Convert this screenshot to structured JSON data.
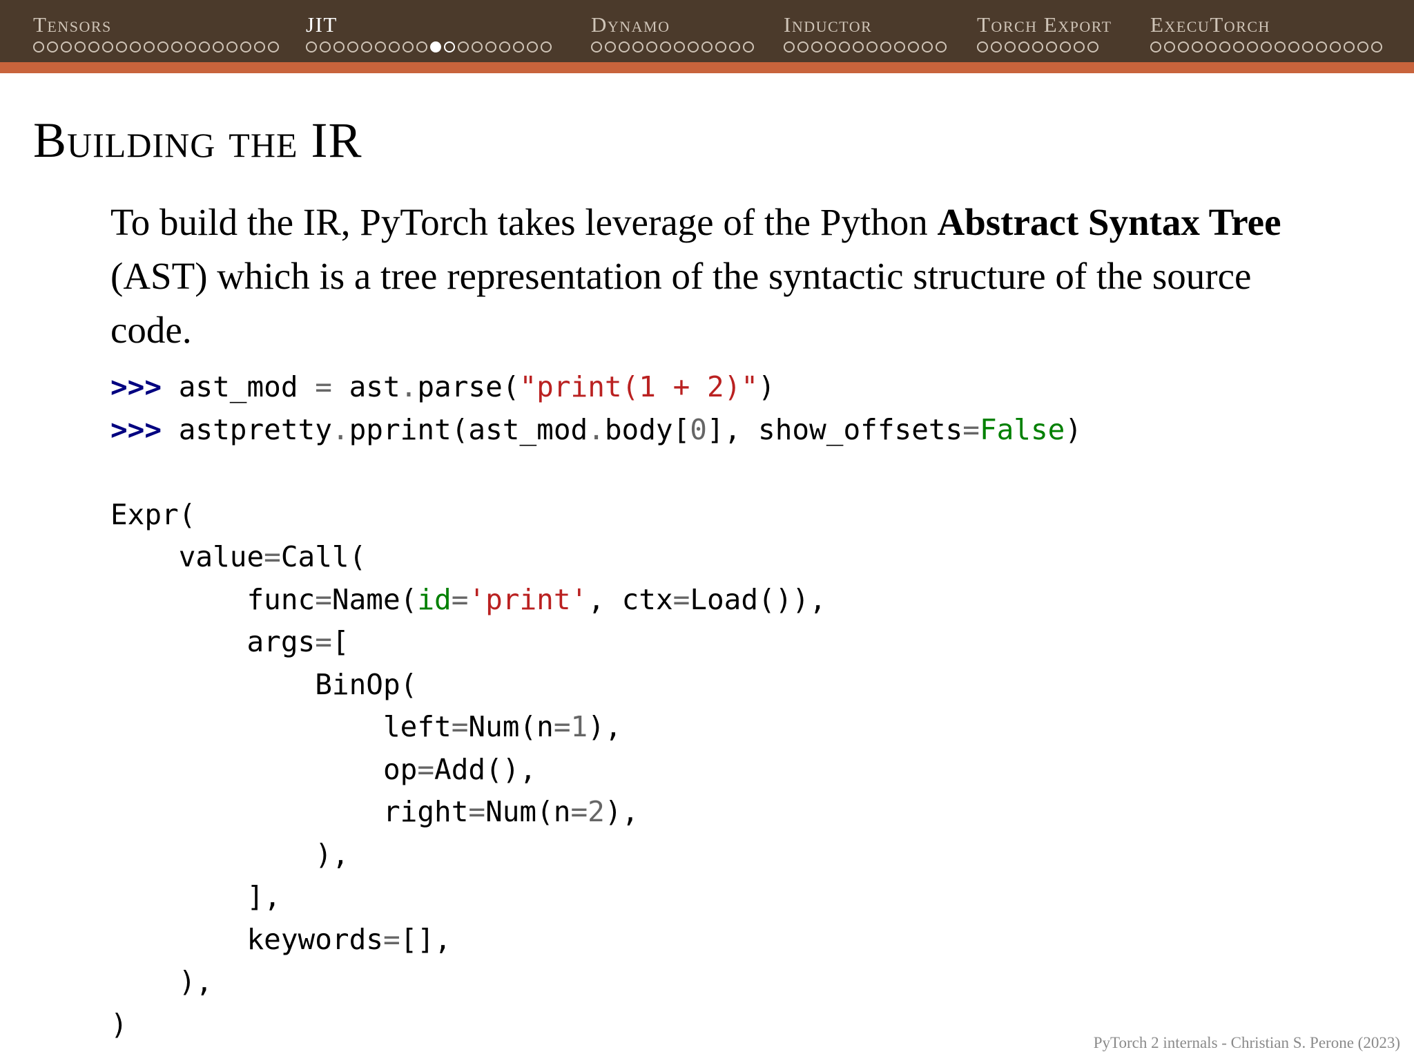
{
  "nav": {
    "sections": [
      {
        "title": "Tensors",
        "dots": 18,
        "active_dot": null,
        "seen_dot": null,
        "active": false
      },
      {
        "title": "JIT",
        "dots": 18,
        "active_dot": 9,
        "seen_dot": 10,
        "active": true
      },
      {
        "title": "Dynamo",
        "dots": 12,
        "active_dot": null,
        "seen_dot": null,
        "active": false
      },
      {
        "title": "Inductor",
        "dots": 12,
        "active_dot": null,
        "seen_dot": null,
        "active": false
      },
      {
        "title": "Torch Export",
        "dots": 9,
        "active_dot": null,
        "seen_dot": null,
        "active": false
      },
      {
        "title": "ExecuTorch",
        "dots": 17,
        "active_dot": null,
        "seen_dot": null,
        "active": false
      }
    ]
  },
  "slide": {
    "title": "Building the IR",
    "paragraph": {
      "part1": "To build the IR, PyTorch takes leverage of the Python ",
      "bold": "Abstract Syntax Tree",
      "part2": " (AST) which is a tree representation of the syntactic structure of the source code."
    },
    "code": {
      "prompt": ">>>",
      "l1_a": "ast_mod",
      "l1_eq": "=",
      "l1_b": "ast",
      "l1_dot": ".",
      "l1_c": "parse(",
      "l1_str": "\"print(1 + 2)\"",
      "l1_end": ")",
      "l2_a": "astpretty",
      "l2_dot": ".",
      "l2_b": "pprint(ast_mod",
      "l2_dot2": ".",
      "l2_c": "body[",
      "l2_num": "0",
      "l2_d": "], show_offsets",
      "l2_eq": "=",
      "l2_kw": "False",
      "l2_end": ")",
      "o1": "Expr(",
      "o2_a": "value",
      "o2_eq": "=",
      "o2_b": "Call(",
      "o3_a": "func",
      "o3_eq": "=",
      "o3_b": "Name(",
      "o3_kw": "id",
      "o3_eq2": "=",
      "o3_str": "'print'",
      "o3_c": ", ctx",
      "o3_eq3": "=",
      "o3_d": "Load()),",
      "o4_a": "args",
      "o4_eq": "=",
      "o4_b": "[",
      "o5": "BinOp(",
      "o6_a": "left",
      "o6_eq": "=",
      "o6_b": "Num(n",
      "o6_eq2": "=",
      "o6_num": "1",
      "o6_c": "),",
      "o7_a": "op",
      "o7_eq": "=",
      "o7_b": "Add(),",
      "o8_a": "right",
      "o8_eq": "=",
      "o8_b": "Num(n",
      "o8_eq2": "=",
      "o8_num": "2",
      "o8_c": "),",
      "o9": "),",
      "o10": "],",
      "o11_a": "keywords",
      "o11_eq": "=",
      "o11_b": "[],",
      "o12": "),",
      "o13": ")"
    },
    "footer": "PyTorch 2 internals - Christian S. Perone (2023)"
  }
}
